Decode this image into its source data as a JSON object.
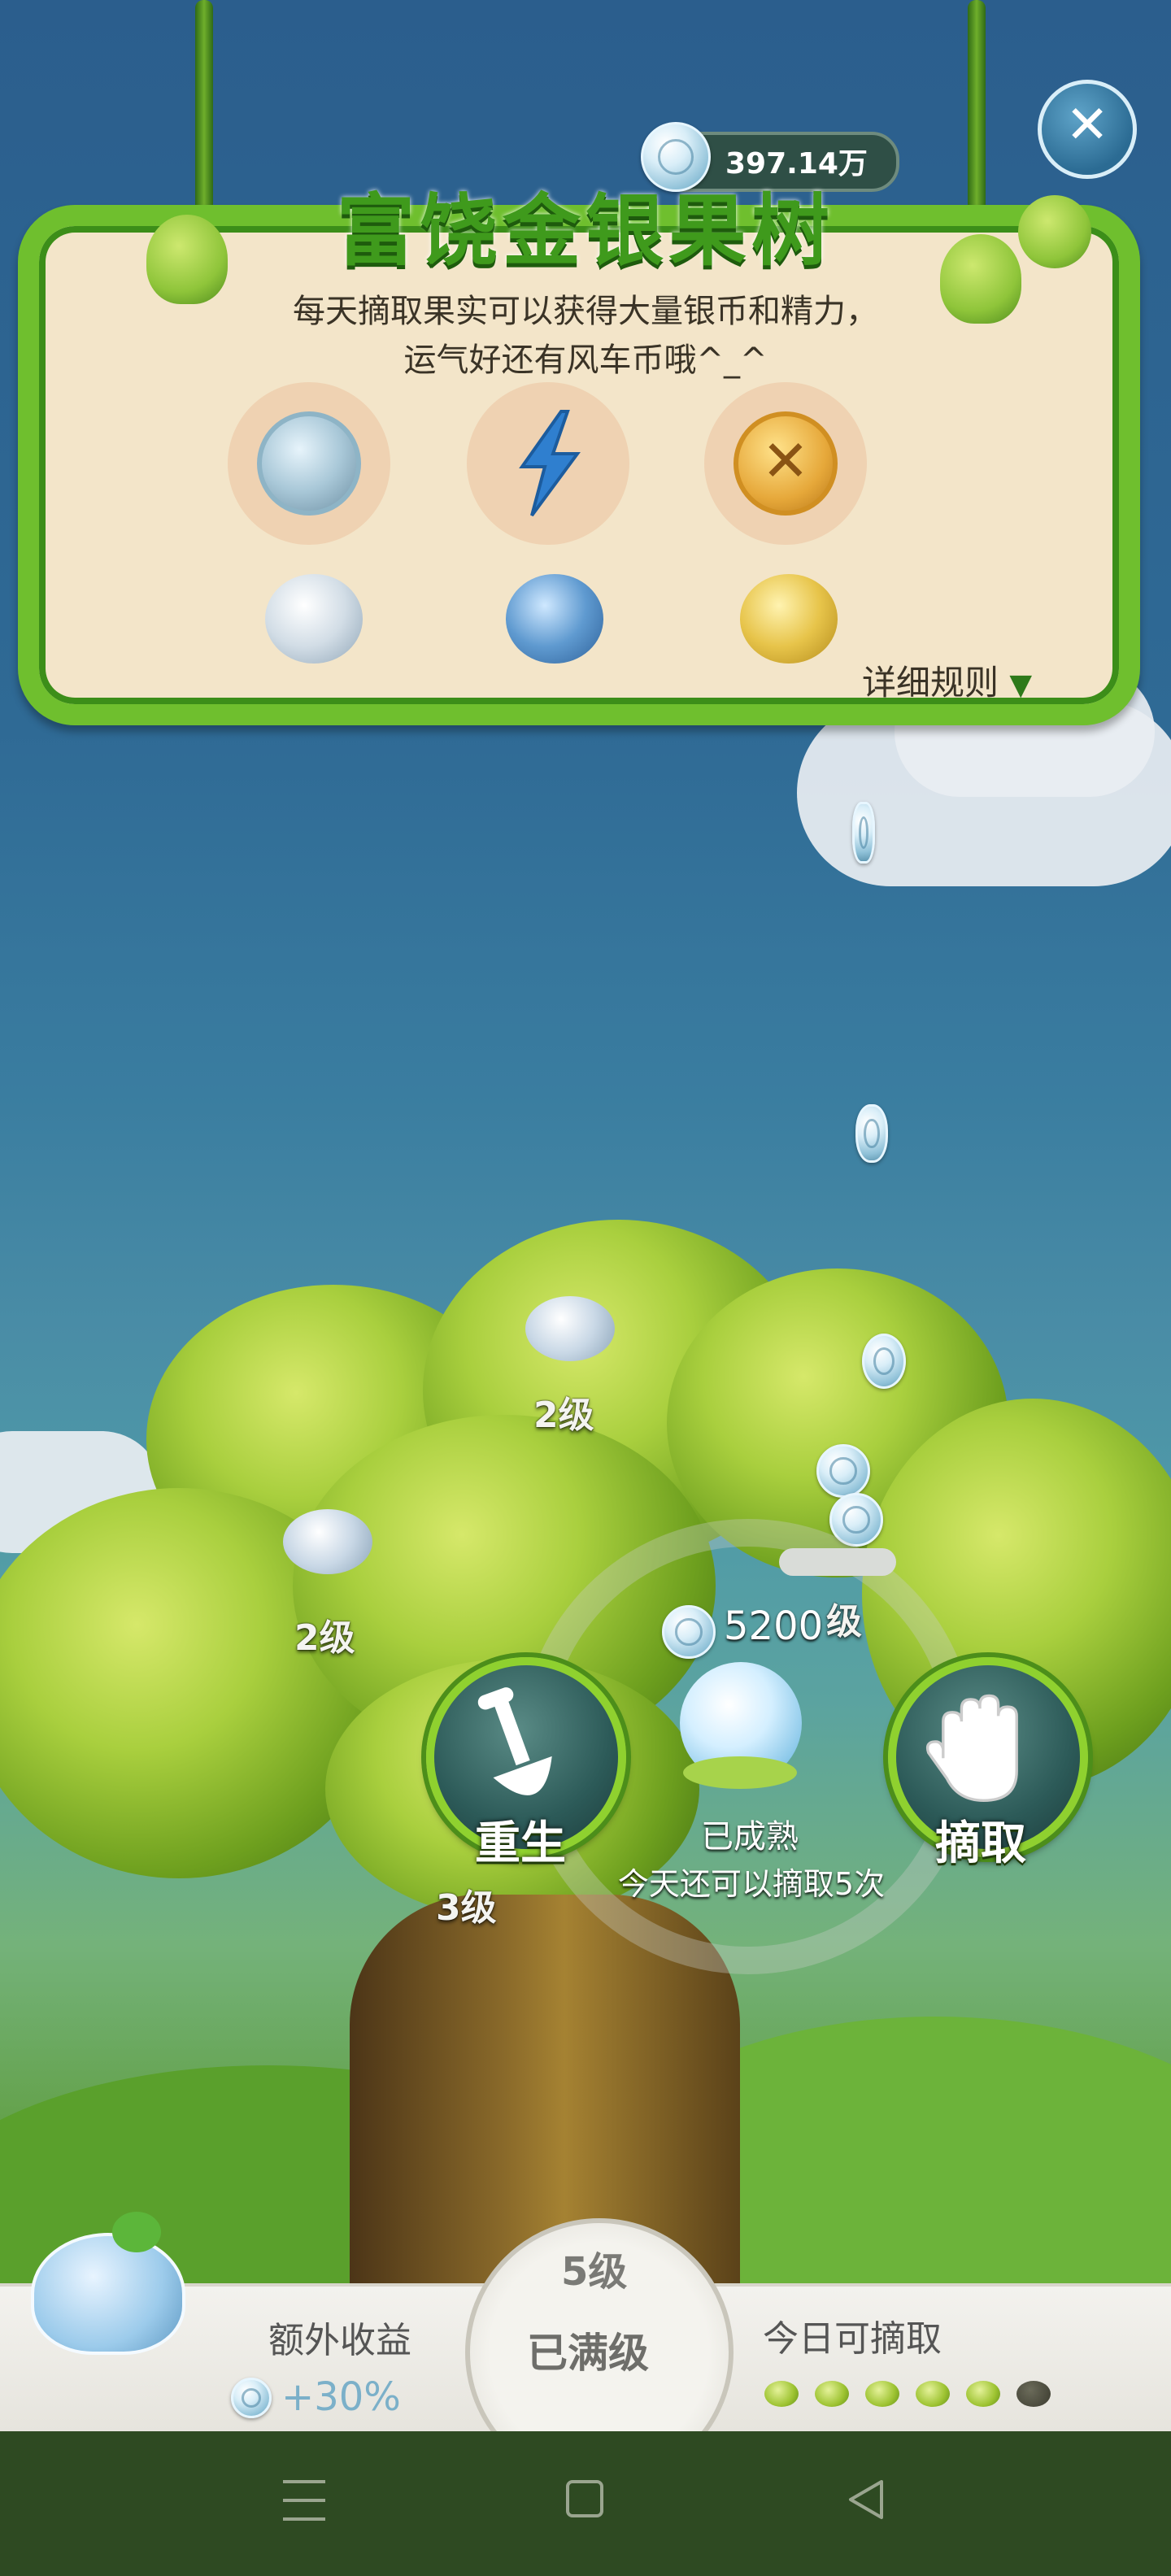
{
  "header": {
    "balance": "397.14万",
    "title": "富饶金银果树",
    "description_line1": "每天摘取果实可以获得大量银币和精力，",
    "description_line2": "运气好还有风车币哦^_^",
    "rules_link": "详细规则"
  },
  "reward_icons": [
    {
      "icon": "silver-coin-icon"
    },
    {
      "icon": "energy-bolt-icon"
    },
    {
      "icon": "windmill-coin-icon"
    }
  ],
  "fruit_icons": [
    {
      "icon": "silver-fruit-icon"
    },
    {
      "icon": "blue-fruit-icon"
    },
    {
      "icon": "gold-fruit-icon"
    }
  ],
  "tree": {
    "branch_levels": [
      "2级",
      "2级",
      "3级",
      "级"
    ],
    "selected_fruit": {
      "reward": "5200",
      "status": "已成熟",
      "remaining": "今天还可以摘取5次"
    },
    "rebirth_label": "重生",
    "pick_label": "摘取"
  },
  "bottom": {
    "extra_income_label": "额外收益",
    "extra_income_value": "+30%",
    "level": "5级",
    "level_status": "已满级",
    "today_label": "今日可摘取",
    "today_available": 5,
    "today_total": 6
  },
  "colors": {
    "accent_green": "#6fbf2e",
    "board_bg": "#f3e5c9",
    "title_green": "#3f9a1c"
  }
}
